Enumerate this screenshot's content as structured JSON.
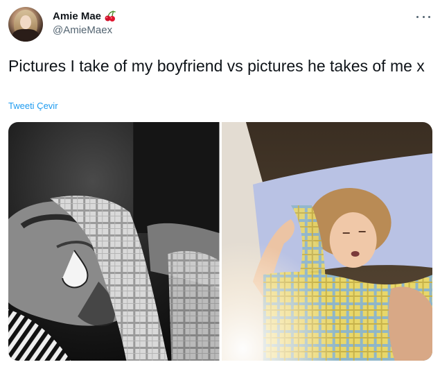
{
  "tweet": {
    "author": {
      "display_name": "Amie Mae",
      "handle": "@AmieMaex",
      "name_emoji": "cherry-icon"
    },
    "text": "Pictures I take of my boyfriend vs pictures he takes of me x",
    "translate_label": "Tweeti Çevir",
    "media": [
      {
        "kind": "photo",
        "subject": "boyfriend-photo"
      },
      {
        "kind": "photo",
        "subject": "girlfriend-photo"
      }
    ]
  },
  "colors": {
    "text": "#0f1419",
    "secondary": "#536471",
    "link": "#1d9bf0"
  }
}
